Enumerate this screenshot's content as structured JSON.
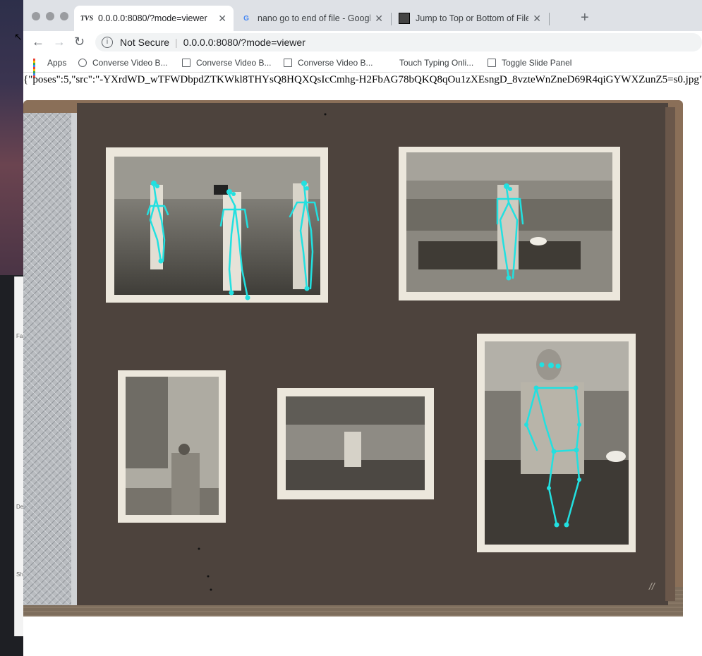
{
  "browser": {
    "tabs": [
      {
        "favicon": "TVS",
        "title": "0.0.0.0:8080/?mode=viewer",
        "active": true
      },
      {
        "favicon": "G",
        "title": "nano go to end of file - Google",
        "active": false
      },
      {
        "favicon": "pixel-icon",
        "title": "Jump to Top or Bottom of File",
        "active": false
      }
    ],
    "security_label": "Not Secure",
    "url": "0.0.0.0:8080/?mode=viewer",
    "bookmarks": [
      {
        "label": "Apps",
        "icon": "apps-grid-icon"
      },
      {
        "label": "Converse Video B...",
        "icon": "circle-icon"
      },
      {
        "label": "Converse Video B...",
        "icon": "document-icon"
      },
      {
        "label": "Converse Video B...",
        "icon": "document-icon"
      },
      {
        "label": "Touch Typing Onli...",
        "icon": "none"
      },
      {
        "label": "Toggle Slide Panel",
        "icon": "document-icon"
      }
    ]
  },
  "page": {
    "json_text": "{\"poses\":5,\"src\":\"-YXrdWD_wTFWDbpdZTKWkl8THYsQ8HQXQsIcCmhg-H2FbAG78bQKQ8qOu1zXEsngD_8vzteWnZneD69R4qiGYWXZunZ5=s0.jpg\"",
    "pose_count": 5,
    "pose_color": "#22e0e0",
    "album_page_color": "#4d433d",
    "corner_mark": "//"
  }
}
